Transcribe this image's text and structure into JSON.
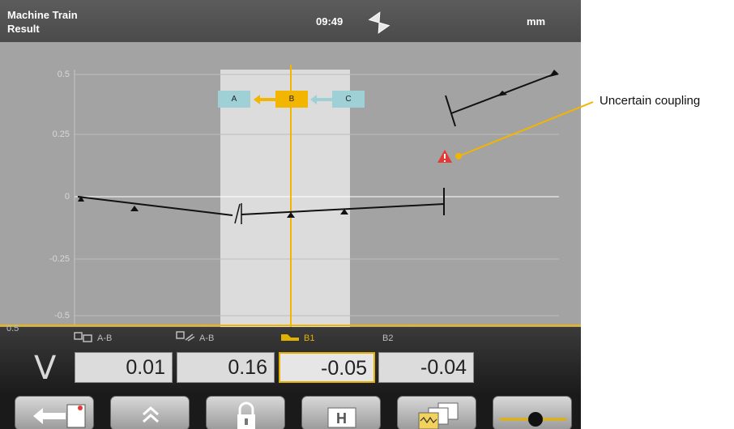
{
  "header": {
    "title": "Machine Train",
    "subtitle": "Result",
    "time": "09:49",
    "unit": "mm"
  },
  "machines": {
    "a": "A",
    "b": "B",
    "c": "C"
  },
  "plot": {
    "y_ticks": [
      "0.5",
      "0.25",
      "0",
      "-0.25",
      "-0.5"
    ],
    "bottom_label": "0.5"
  },
  "values": {
    "direction": "V",
    "items": [
      {
        "label": "A-B",
        "value": "0.01"
      },
      {
        "label": "A-B",
        "value": "0.16"
      },
      {
        "label": "B1",
        "value": "-0.05"
      },
      {
        "label": "B2",
        "value": "-0.04"
      }
    ]
  },
  "annotation": {
    "text": "Uncertain coupling"
  },
  "toolbar": {
    "buttons": [
      "back-icon",
      "chevrons-up-icon",
      "lock-icon",
      "horizontal-icon",
      "tolerance-icon",
      "slider-icon"
    ]
  },
  "colors": {
    "accent": "#f2b500",
    "machine_tab": "#9fd0d6",
    "warning": "#e53935"
  }
}
